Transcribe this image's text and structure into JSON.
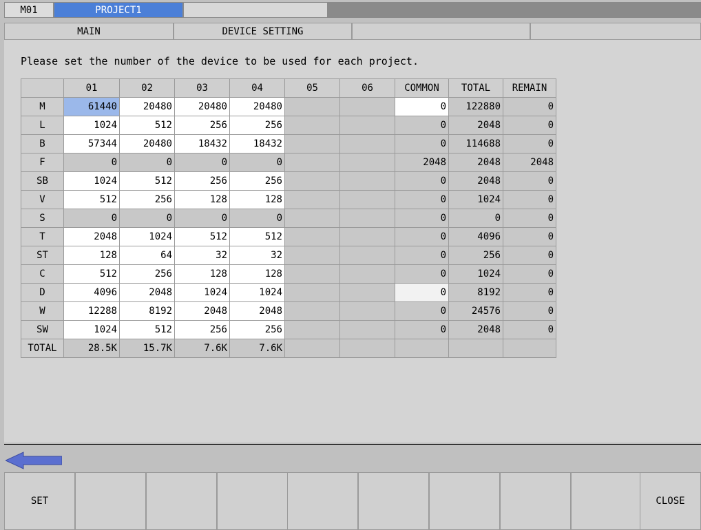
{
  "tabs": {
    "machine": "M01",
    "project": "PROJECT1"
  },
  "subtabs": [
    "MAIN",
    "DEVICE SETTING",
    "",
    "",
    ""
  ],
  "instruction": "Please set the number of the device to be used for each project.",
  "table": {
    "headers": [
      "",
      "01",
      "02",
      "03",
      "04",
      "05",
      "06",
      "COMMON",
      "TOTAL",
      "REMAIN"
    ],
    "rows": [
      {
        "device": "M",
        "values": [
          "61440",
          "20480",
          "20480",
          "20480",
          "",
          "",
          "0",
          "122880",
          "0"
        ]
      },
      {
        "device": "L",
        "values": [
          "1024",
          "512",
          "256",
          "256",
          "",
          "",
          "0",
          "2048",
          "0"
        ]
      },
      {
        "device": "B",
        "values": [
          "57344",
          "20480",
          "18432",
          "18432",
          "",
          "",
          "0",
          "114688",
          "0"
        ]
      },
      {
        "device": "F",
        "values": [
          "0",
          "0",
          "0",
          "0",
          "",
          "",
          "2048",
          "2048",
          "2048"
        ]
      },
      {
        "device": "SB",
        "values": [
          "1024",
          "512",
          "256",
          "256",
          "",
          "",
          "0",
          "2048",
          "0"
        ]
      },
      {
        "device": "V",
        "values": [
          "512",
          "256",
          "128",
          "128",
          "",
          "",
          "0",
          "1024",
          "0"
        ]
      },
      {
        "device": "S",
        "values": [
          "0",
          "0",
          "0",
          "0",
          "",
          "",
          "0",
          "0",
          "0"
        ]
      },
      {
        "device": "T",
        "values": [
          "2048",
          "1024",
          "512",
          "512",
          "",
          "",
          "0",
          "4096",
          "0"
        ]
      },
      {
        "device": "ST",
        "values": [
          "128",
          "64",
          "32",
          "32",
          "",
          "",
          "0",
          "256",
          "0"
        ]
      },
      {
        "device": "C",
        "values": [
          "512",
          "256",
          "128",
          "128",
          "",
          "",
          "0",
          "1024",
          "0"
        ]
      },
      {
        "device": "D",
        "values": [
          "4096",
          "2048",
          "1024",
          "1024",
          "",
          "",
          "0",
          "8192",
          "0"
        ]
      },
      {
        "device": "W",
        "values": [
          "12288",
          "8192",
          "2048",
          "2048",
          "",
          "",
          "0",
          "24576",
          "0"
        ]
      },
      {
        "device": "SW",
        "values": [
          "1024",
          "512",
          "256",
          "256",
          "",
          "",
          "0",
          "2048",
          "0"
        ]
      }
    ],
    "total_row": {
      "label": "TOTAL",
      "values": [
        "28.5K",
        "15.7K",
        "7.6K",
        "7.6K",
        "",
        "",
        "",
        "",
        ""
      ]
    },
    "selected_cell": {
      "row": 0,
      "col": 0
    }
  },
  "icons": {
    "back": "arrow-left-icon"
  },
  "function_keys": [
    "SET",
    "",
    "",
    "",
    "",
    "",
    "",
    "",
    "",
    "CLOSE"
  ],
  "colors": {
    "active_tab": "#4b7fd8",
    "selected_cell": "#9bb8ea",
    "arrow": "#5b6fd0"
  }
}
